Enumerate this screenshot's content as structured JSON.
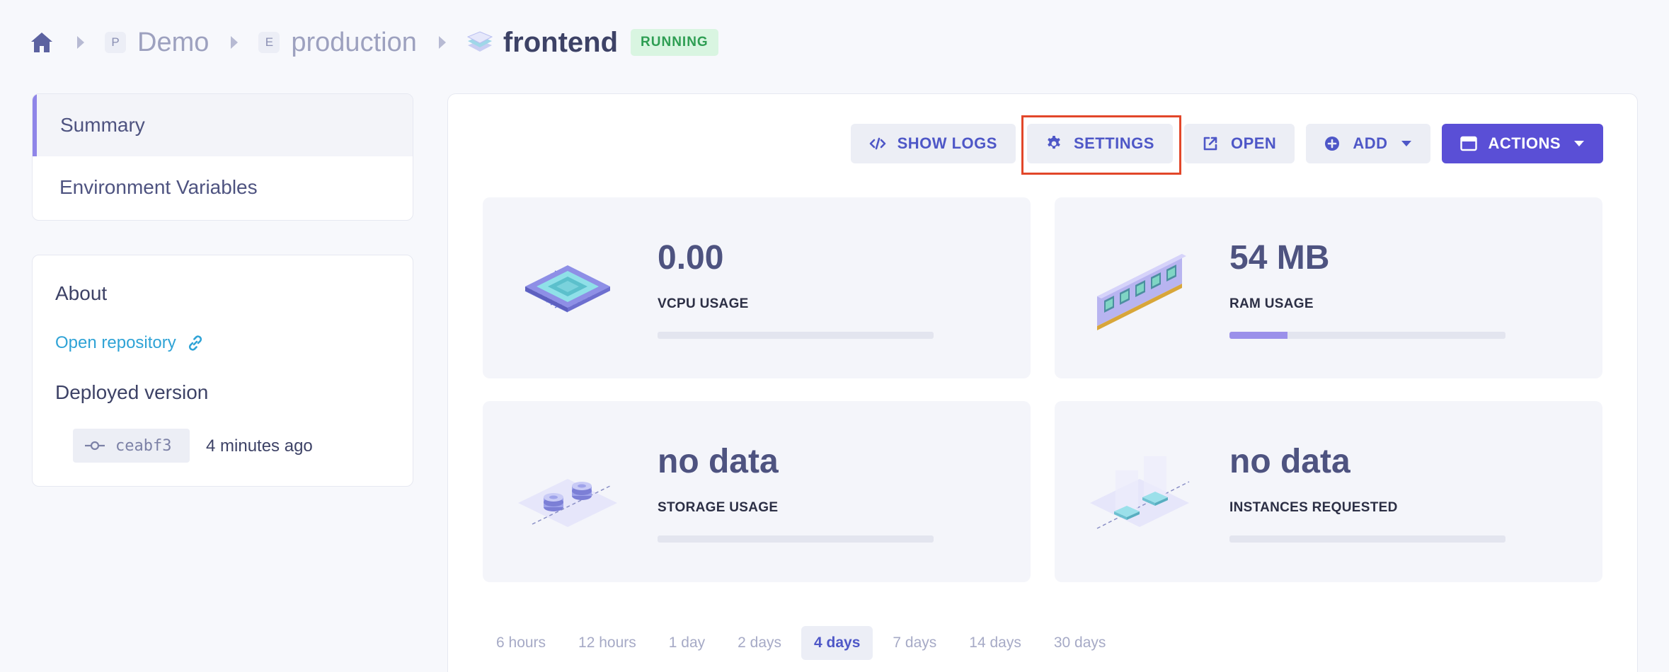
{
  "breadcrumb": {
    "project_badge": "P",
    "project": "Demo",
    "environment_badge": "E",
    "environment": "production",
    "service": "frontend",
    "status": "RUNNING"
  },
  "nav": {
    "items": [
      {
        "label": "Summary",
        "active": true
      },
      {
        "label": "Environment Variables",
        "active": false
      }
    ]
  },
  "about": {
    "title": "About",
    "repo_link": "Open repository",
    "deployed_title": "Deployed version",
    "commit_hash": "ceabf3",
    "commit_time": "4 minutes ago"
  },
  "toolbar": {
    "show_logs": "SHOW LOGS",
    "settings": "SETTINGS",
    "open": "OPEN",
    "add": "ADD",
    "actions": "ACTIONS"
  },
  "metrics": [
    {
      "value": "0.00",
      "label": "VCPU USAGE",
      "fill_fraction": 0.0
    },
    {
      "value": "54 MB",
      "label": "RAM USAGE",
      "fill_fraction": 0.21
    },
    {
      "value": "no data",
      "label": "STORAGE USAGE",
      "fill_fraction": 0.0
    },
    {
      "value": "no data",
      "label": "INSTANCES REQUESTED",
      "fill_fraction": 0.0
    }
  ],
  "time_ranges": {
    "options": [
      "6 hours",
      "12 hours",
      "1 day",
      "2 days",
      "4 days",
      "7 days",
      "14 days",
      "30 days"
    ],
    "selected": "4 days"
  },
  "colors": {
    "accent": "#5a4fd6",
    "running": "#2e9e53",
    "highlight": "#e2472a",
    "bar_fill": "#9b90ea"
  }
}
